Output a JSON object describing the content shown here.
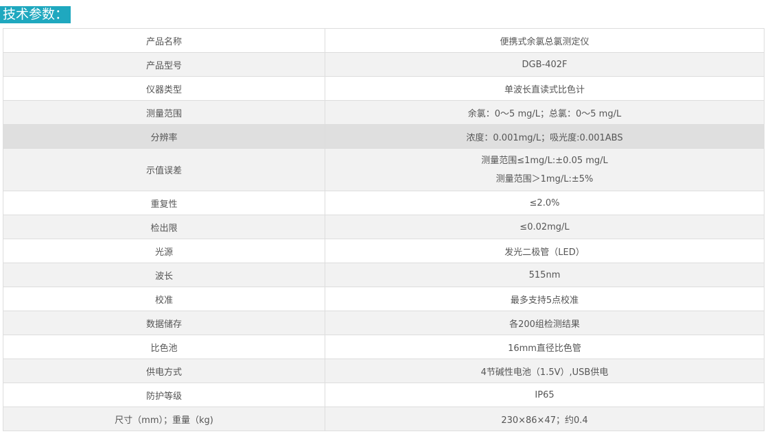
{
  "heading": "技术参数：",
  "rows": [
    {
      "label": "产品名称",
      "value": "便携式余氯总氯测定仪"
    },
    {
      "label": "产品型号",
      "value": "DGB-402F"
    },
    {
      "label": "仪器类型",
      "value": "单波长直读式比色计"
    },
    {
      "label": "测量范围",
      "value": "余氯：0～5 mg/L；总氯：0～5 mg/L"
    },
    {
      "label": "分辨率",
      "value": "浓度：0.001mg/L；吸光度:0.001ABS"
    },
    {
      "label": "示值误差",
      "value_line1": "测量范围≤1mg/L:±0.05 mg/L",
      "value_line2": "测量范围＞1mg/L:±5%"
    },
    {
      "label": "重复性",
      "value": "≤2.0%"
    },
    {
      "label": "检出限",
      "value": "≤0.02mg/L"
    },
    {
      "label": "光源",
      "value": "发光二极管（LED）"
    },
    {
      "label": "波长",
      "value": "515nm"
    },
    {
      "label": "校准",
      "value": "最多支持5点校准"
    },
    {
      "label": "数据储存",
      "value": "各200组检测结果"
    },
    {
      "label": "比色池",
      "value": "16mm直径比色管"
    },
    {
      "label": "供电方式",
      "value": "4节碱性电池（1.5V）,USB供电"
    },
    {
      "label": "防护等级",
      "value": "IP65"
    },
    {
      "label": "尺寸（mm）；重量（kg)",
      "value": "230×86×47；约0.4"
    }
  ]
}
